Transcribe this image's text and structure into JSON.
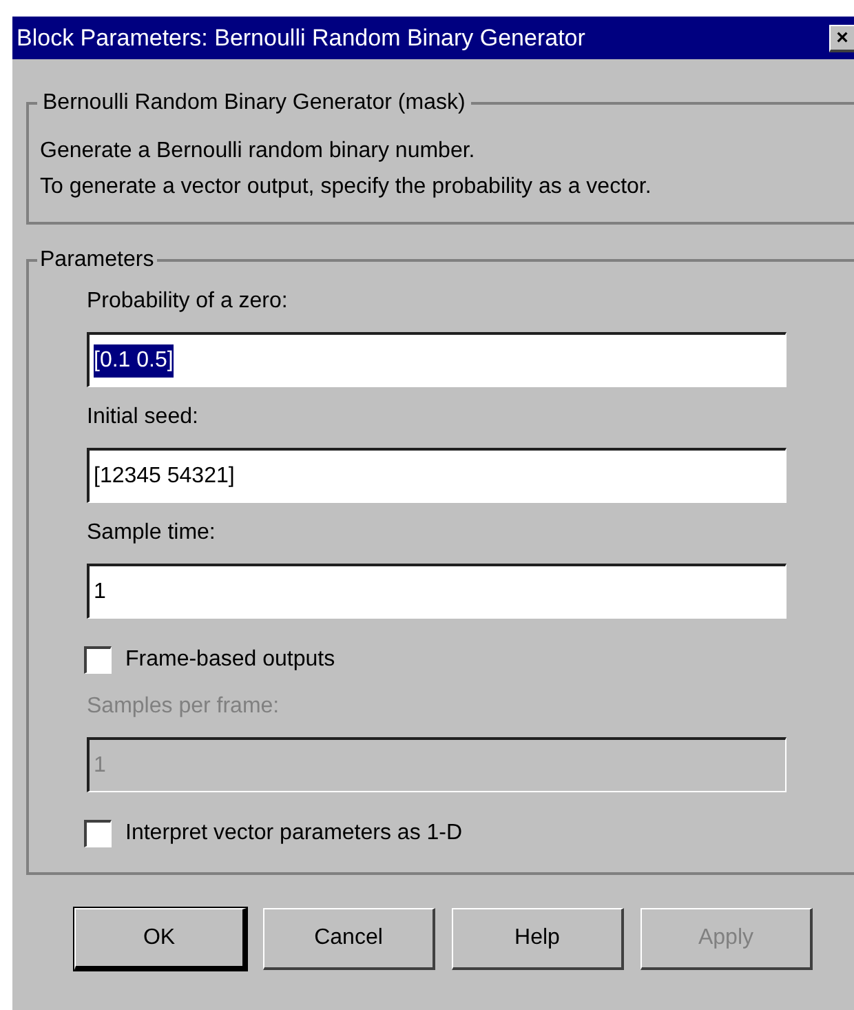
{
  "window": {
    "title": "Block Parameters: Bernoulli Random Binary Generator",
    "close": "×"
  },
  "description_group": {
    "title": "Bernoulli Random Binary Generator (mask)",
    "lines": [
      "Generate a Bernoulli random binary number.",
      "To generate a vector output, specify the probability as a vector."
    ]
  },
  "parameters_group": {
    "title": "Parameters",
    "items": [
      {
        "kind": "field",
        "label": "Probability of a zero:",
        "value": "[0.1 0.5]",
        "disabled": false,
        "text_selected": true
      },
      {
        "kind": "field",
        "label": "Initial seed:",
        "value": "[12345 54321]",
        "disabled": false,
        "text_selected": false
      },
      {
        "kind": "field",
        "label": "Sample time:",
        "value": "1",
        "disabled": false,
        "text_selected": false
      },
      {
        "kind": "checkbox",
        "label": "Frame-based outputs",
        "checked": false
      },
      {
        "kind": "field",
        "label": "Samples per frame:",
        "value": "1",
        "disabled": true,
        "text_selected": false
      },
      {
        "kind": "checkbox",
        "label": "Interpret vector parameters as 1-D",
        "checked": false
      }
    ]
  },
  "buttons": [
    {
      "label": "OK",
      "default": true,
      "disabled": false
    },
    {
      "label": "Cancel",
      "default": false,
      "disabled": false
    },
    {
      "label": "Help",
      "default": false,
      "disabled": false
    },
    {
      "label": "Apply",
      "default": false,
      "disabled": true
    }
  ]
}
